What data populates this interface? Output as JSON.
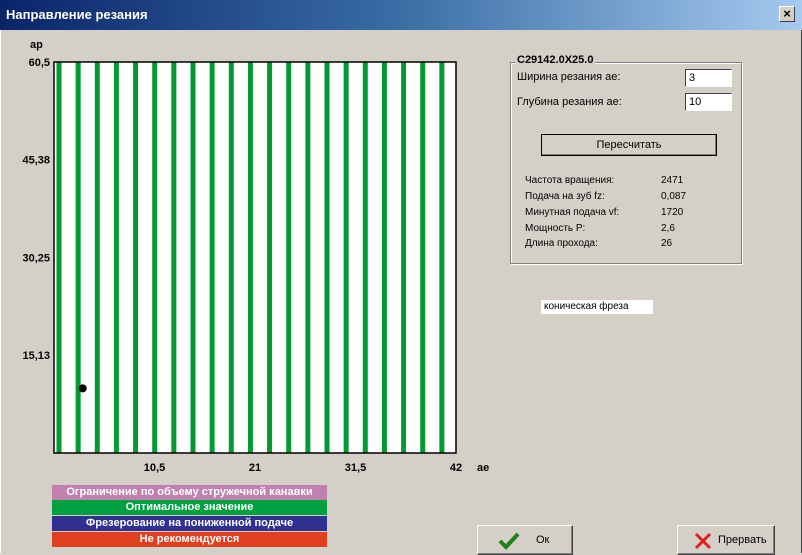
{
  "window": {
    "title": "Направление резания",
    "close_glyph": "×"
  },
  "chart_data": {
    "type": "scatter",
    "xlabel": "ae",
    "ylabel": "ap",
    "xlim": [
      0,
      42
    ],
    "ylim": [
      0,
      60.5
    ],
    "x_ticks": [
      "10,5",
      "21",
      "31,5",
      "42"
    ],
    "y_ticks": [
      "60,5",
      "45,38",
      "30,25",
      "15,13"
    ],
    "x_tick_values": [
      10.5,
      21,
      31.5,
      42
    ],
    "y_tick_values": [
      60.5,
      45.38,
      30.25,
      15.13
    ],
    "stripe_color": "#009933",
    "stripe_count": 21,
    "points": [
      {
        "x": 3,
        "y": 10
      }
    ],
    "point_color": "#000000"
  },
  "legend": [
    {
      "label": "Ограничение по объему стружечной канавки",
      "color": "#c080b0"
    },
    {
      "label": "Оптимальное значение",
      "color": "#00a040"
    },
    {
      "label": "Фрезерование на пониженной подаче",
      "color": "#303090"
    },
    {
      "label": "Не рекомендуется",
      "color": "#e04020"
    }
  ],
  "tool": {
    "name": "C29142.0X25.0",
    "width_label": "Ширина резания ae:",
    "width_value": "3",
    "depth_label": "Глубина резания ae:",
    "depth_value": "10",
    "recalc_label": "Пересчитать",
    "results": [
      {
        "label": "Частота вращения:",
        "value": "2471"
      },
      {
        "label": "Подача на зуб fz:",
        "value": "0,087"
      },
      {
        "label": "Минутная подача vf:",
        "value": "1720"
      },
      {
        "label": "Мощность P:",
        "value": "2,6"
      },
      {
        "label": "Длина прохода:",
        "value": "26"
      }
    ],
    "type": "коническая фреза"
  },
  "buttons": {
    "ok_label": "Ок",
    "cancel_label": "Прервать"
  }
}
